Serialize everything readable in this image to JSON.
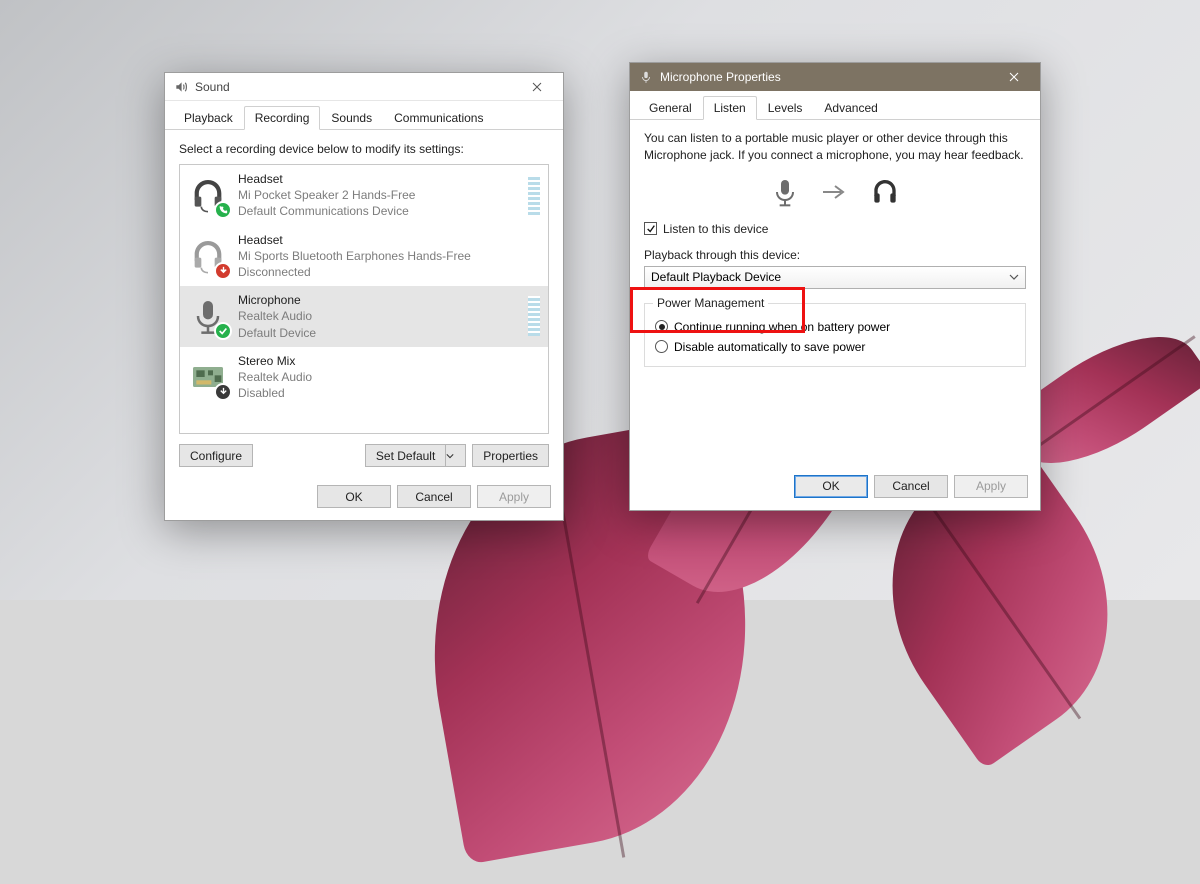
{
  "sound": {
    "title": "Sound",
    "tabs": [
      "Playback",
      "Recording",
      "Sounds",
      "Communications"
    ],
    "active_tab": 1,
    "instruction": "Select a recording device below to modify its settings:",
    "devices": [
      {
        "name": "Headset",
        "sub1": "Mi Pocket Speaker 2 Hands-Free",
        "sub2": "Default Communications Device",
        "icon": "headset",
        "badge": "phone-green"
      },
      {
        "name": "Headset",
        "sub1": "Mi Sports Bluetooth Earphones Hands-Free",
        "sub2": "Disconnected",
        "icon": "headset",
        "badge": "down-red"
      },
      {
        "name": "Microphone",
        "sub1": "Realtek Audio",
        "sub2": "Default Device",
        "icon": "mic",
        "badge": "check-green"
      },
      {
        "name": "Stereo Mix",
        "sub1": "Realtek Audio",
        "sub2": "Disabled",
        "icon": "chip",
        "badge": "down-dark"
      }
    ],
    "selected_index": 2,
    "buttons": {
      "configure": "Configure",
      "set_default": "Set Default",
      "properties": "Properties"
    },
    "footer": {
      "ok": "OK",
      "cancel": "Cancel",
      "apply": "Apply"
    }
  },
  "mic": {
    "title": "Microphone Properties",
    "tabs": [
      "General",
      "Listen",
      "Levels",
      "Advanced"
    ],
    "active_tab": 1,
    "info": "You can listen to a portable music player or other device through this Microphone jack.  If you connect a microphone, you may hear feedback.",
    "listen_label": "Listen to this device",
    "listen_checked": true,
    "playback_label": "Playback through this device:",
    "playback_value": "Default Playback Device",
    "power_legend": "Power Management",
    "radio1": "Continue running when on battery power",
    "radio2": "Disable automatically to save power",
    "radio_selected": 0,
    "footer": {
      "ok": "OK",
      "cancel": "Cancel",
      "apply": "Apply"
    }
  }
}
